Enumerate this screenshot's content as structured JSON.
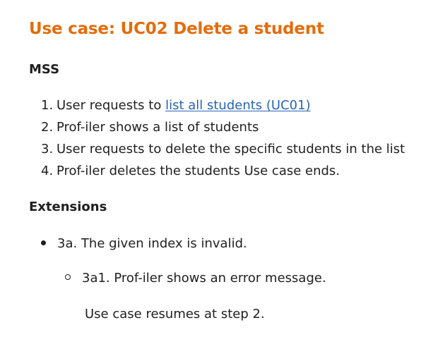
{
  "title": "Use case: UC02 Delete a student",
  "mss": {
    "heading": "MSS",
    "steps": [
      {
        "num": "1.",
        "text": "User requests to ",
        "link": "list all students (UC01)"
      },
      {
        "num": "2.",
        "text": "Prof-iler shows a list of students"
      },
      {
        "num": "3.",
        "text": "User requests to delete the specific students in the list"
      },
      {
        "num": "4.",
        "text": "Prof-iler deletes the students Use case ends."
      }
    ]
  },
  "extensions": {
    "heading": "Extensions",
    "items": [
      {
        "text": "3a. The given index is invalid.",
        "sub": [
          {
            "text": "3a1. Prof-iler shows an error message."
          }
        ],
        "resume": "Use case resumes at step 2."
      }
    ]
  },
  "colors": {
    "title": "#e46c0a",
    "link": "#2864b4",
    "text": "#1f1f1f"
  }
}
